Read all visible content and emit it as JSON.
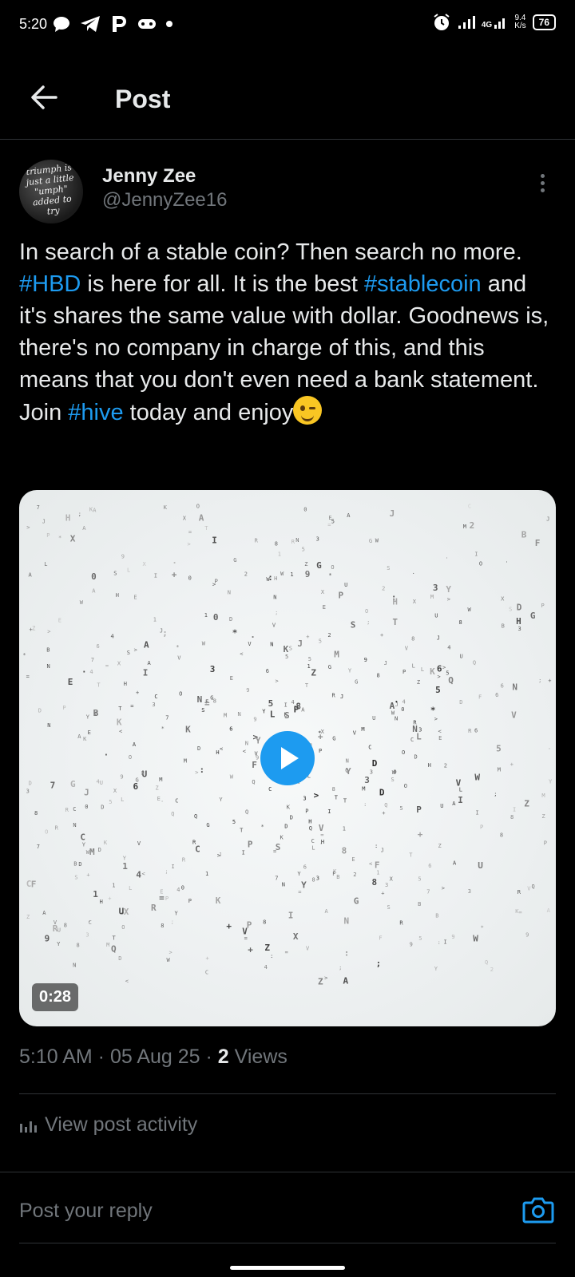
{
  "status_bar": {
    "time": "5:20",
    "network": "4G",
    "speed_value": "9.4",
    "speed_unit": "K/s",
    "battery": "76"
  },
  "header": {
    "title": "Post"
  },
  "post": {
    "author": {
      "display_name": "Jenny Zee",
      "handle": "@JennyZee16",
      "avatar_text": "triumph is just a little \"umph\" added to try"
    },
    "text_segments": {
      "s1": "In search of a stable coin? Then search no more. ",
      "tag1": "#HBD",
      "s2": " is here for all. It is the best ",
      "tag2": "#stablecoin",
      "s3": "  and it's shares the same value with dollar. Goodnews is, there's no company in charge of this, and this means that you don't even need a bank statement. Join ",
      "tag3": "#hive",
      "s4": " today and enjoy"
    },
    "media": {
      "duration": "0:28"
    },
    "meta": {
      "time": "5:10 AM",
      "date": "05 Aug 25",
      "views_count": "2",
      "views_label": "Views",
      "separator": " · "
    }
  },
  "actions": {
    "view_activity": "View post activity"
  },
  "reply": {
    "placeholder": "Post your reply"
  },
  "colors": {
    "accent": "#1d9bf0",
    "muted": "#71767b",
    "background": "#000000"
  }
}
